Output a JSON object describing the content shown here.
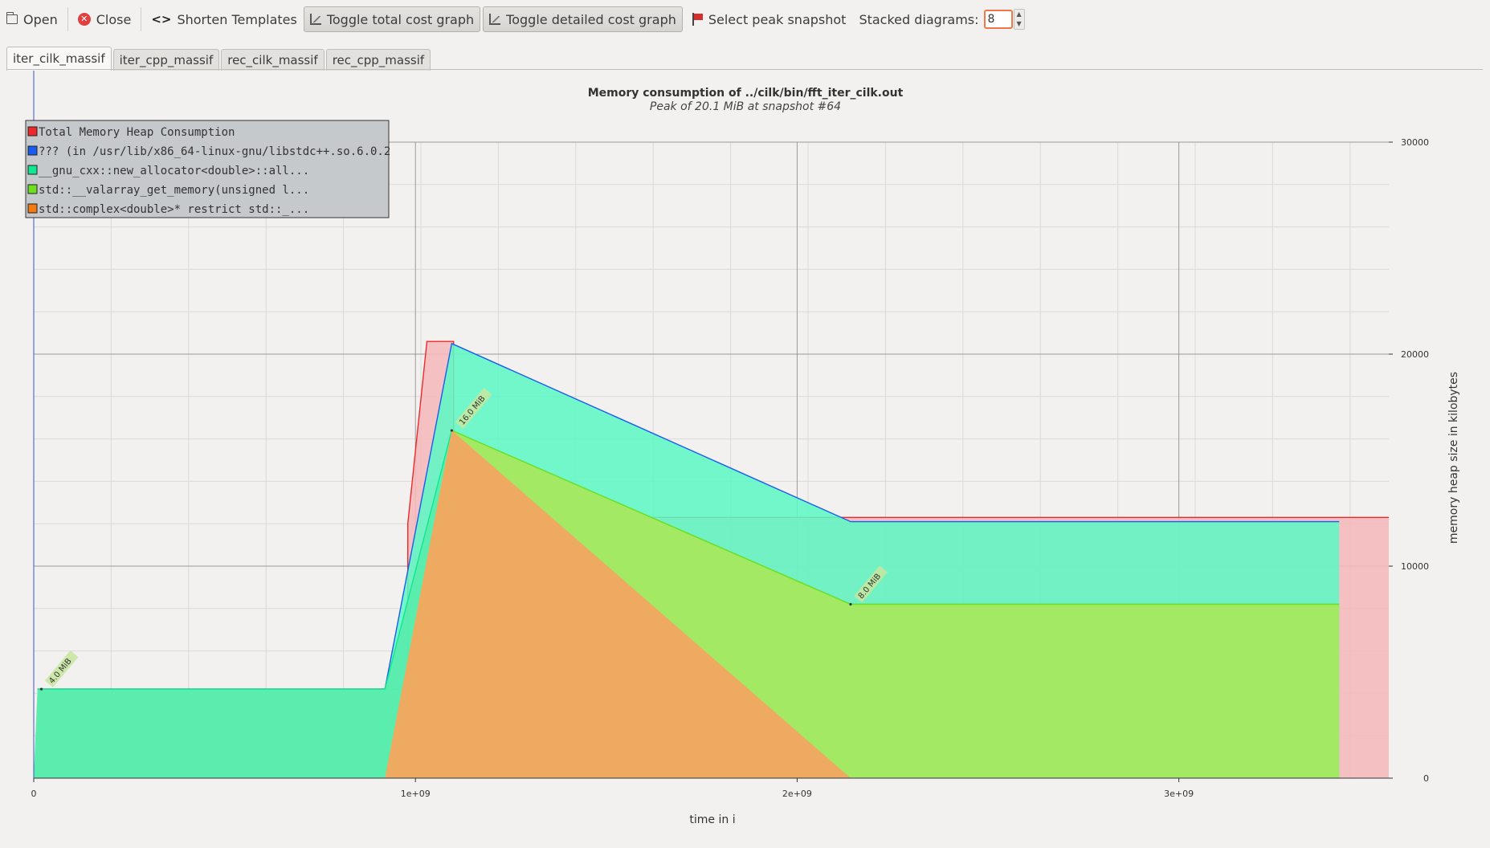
{
  "toolbar": {
    "open_label": "Open",
    "close_label": "Close",
    "shorten_label": "Shorten Templates",
    "toggle_total_label": "Toggle total cost graph",
    "toggle_detailed_label": "Toggle detailed cost graph",
    "select_peak_label": "Select peak snapshot",
    "stacked_label": "Stacked diagrams:",
    "stacked_value": "8"
  },
  "tabs": [
    {
      "label": "iter_cilk_massif",
      "active": true
    },
    {
      "label": "iter_cpp_massif",
      "active": false
    },
    {
      "label": "rec_cilk_massif",
      "active": false
    },
    {
      "label": "rec_cpp_massif",
      "active": false
    }
  ],
  "chart_data": {
    "type": "area",
    "title": "Memory consumption of ../cilk/bin/fft_iter_cilk.out",
    "subtitle": "Peak of 20.1 MiB at snapshot #64",
    "xlabel": "time in i",
    "ylabel": "memory heap size in kilobytes",
    "xlim": [
      0,
      3550000000
    ],
    "ylim": [
      0,
      30000
    ],
    "x_ticks": [
      {
        "value": 0,
        "label": "0"
      },
      {
        "value": 1000000000,
        "label": "1e+09"
      },
      {
        "value": 2000000000,
        "label": "2e+09"
      },
      {
        "value": 3000000000,
        "label": "3e+09"
      }
    ],
    "y_ticks": [
      {
        "value": 0,
        "label": "0"
      },
      {
        "value": 10000,
        "label": "10000"
      },
      {
        "value": 20000,
        "label": "20000"
      },
      {
        "value": 30000,
        "label": "30000"
      }
    ],
    "grid": true,
    "legend_position": "top-left",
    "series": [
      {
        "name": "Total Memory Heap Consumption",
        "color": "#ef2929",
        "fill": "#f4b8bb",
        "points": [
          [
            0,
            0
          ],
          [
            10000000,
            4200
          ],
          [
            980000000,
            4200
          ],
          [
            980000000,
            12000
          ],
          [
            1030000000,
            20600
          ],
          [
            1100000000,
            20600
          ],
          [
            1100000000,
            12300
          ],
          [
            3550000000,
            12300
          ],
          [
            3550000000,
            0
          ]
        ]
      },
      {
        "name": "??? (in /usr/lib/x86_64-linux-gnu/libstdc++.so.6.0.2",
        "color": "#1a5cf0",
        "fill": "#5ef7c4",
        "points": [
          [
            0,
            0
          ],
          [
            10000000,
            4200
          ],
          [
            920000000,
            4200
          ],
          [
            1095000000,
            20500
          ],
          [
            2140000000,
            12100
          ],
          [
            3420000000,
            12100
          ],
          [
            3420000000,
            0
          ]
        ]
      },
      {
        "name": "__gnu_cxx::new_allocator<double>::all...",
        "color": "#10e890",
        "fill": "#56ecab",
        "points": [
          [
            0,
            0
          ],
          [
            10000000,
            4200
          ],
          [
            920000000,
            4200
          ],
          [
            1095000000,
            16400
          ],
          [
            2140000000,
            8200
          ],
          [
            3420000000,
            8200
          ],
          [
            3420000000,
            0
          ]
        ]
      },
      {
        "name": "std::__valarray_get_memory(unsigned l...",
        "color": "#6ee020",
        "fill": "#aee85a",
        "points": [
          [
            920000000,
            0
          ],
          [
            1095000000,
            16400
          ],
          [
            2140000000,
            8200
          ],
          [
            3420000000,
            8200
          ],
          [
            3420000000,
            0
          ]
        ]
      },
      {
        "name": "std::complex<double>* restrict std::_...",
        "color": "#f57a10",
        "fill": "#f8a060",
        "points": [
          [
            920000000,
            0
          ],
          [
            1095000000,
            16400
          ],
          [
            2140000000,
            0
          ]
        ]
      }
    ],
    "annotations": [
      {
        "text": "4.0 MiB",
        "x": 20000000,
        "y": 4200
      },
      {
        "text": "16.0 MiB",
        "x": 1095000000,
        "y": 16400
      },
      {
        "text": "8.0 MiB",
        "x": 2140000000,
        "y": 8200
      }
    ]
  }
}
